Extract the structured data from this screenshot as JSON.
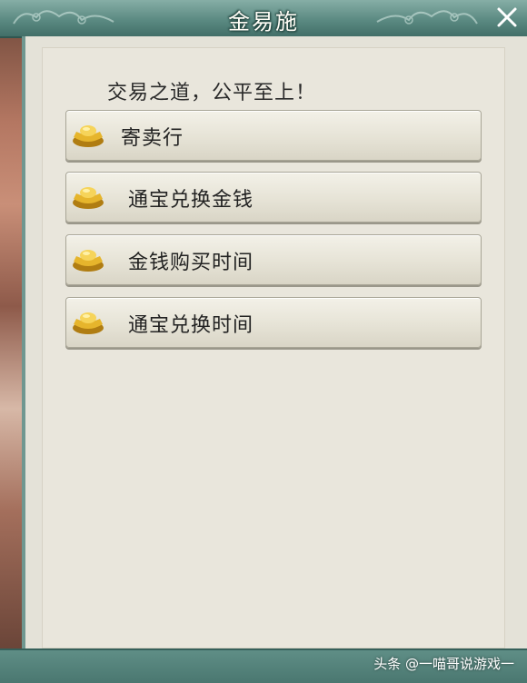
{
  "window": {
    "title": "金易施",
    "close_icon": "close-icon"
  },
  "dialog": {
    "slogan": "交易之道，公平至上！"
  },
  "menu": {
    "items": [
      {
        "label": "寄卖行",
        "icon": "gold-ingot-icon"
      },
      {
        "label": "通宝兑换金钱",
        "icon": "gold-ingot-icon"
      },
      {
        "label": "金钱购买时间",
        "icon": "gold-ingot-icon"
      },
      {
        "label": "通宝兑换时间",
        "icon": "gold-ingot-icon"
      }
    ]
  },
  "watermark": {
    "text": "头条 @一喵哥说游戏一"
  },
  "colors": {
    "titlebar": "#5b8a82",
    "panel": "#e9e6dc",
    "button": "#e6e3d6",
    "gold": "#e0b32a"
  }
}
